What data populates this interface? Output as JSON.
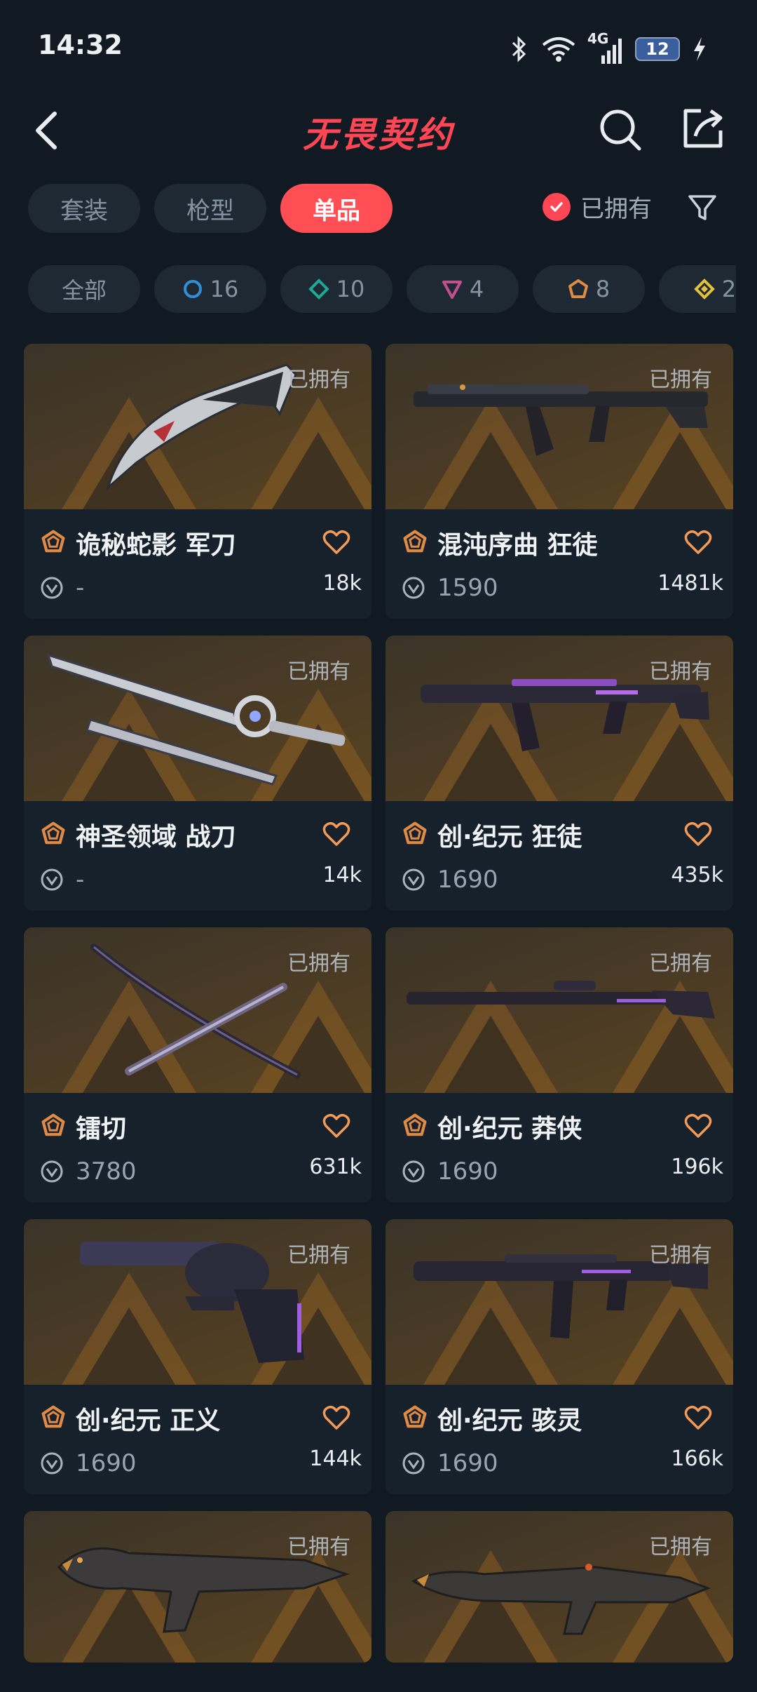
{
  "status": {
    "time": "14:32",
    "network": "4G",
    "battery": "12"
  },
  "header": {
    "title": "无畏契约"
  },
  "tabs": [
    {
      "label": "套装",
      "active": false
    },
    {
      "label": "枪型",
      "active": false
    },
    {
      "label": "单品",
      "active": true
    }
  ],
  "owned_filter": {
    "label": "已拥有",
    "checked": true
  },
  "rarity_chips": [
    {
      "label": "全部",
      "count": "",
      "icon": "all",
      "color": ""
    },
    {
      "label": "",
      "count": "16",
      "icon": "select-tier-icon",
      "color": "#2f8fd8"
    },
    {
      "label": "",
      "count": "10",
      "icon": "deluxe-tier-icon",
      "color": "#1fa894"
    },
    {
      "label": "",
      "count": "4",
      "icon": "premium-tier-icon",
      "color": "#c0508f"
    },
    {
      "label": "",
      "count": "8",
      "icon": "exclusive-tier-icon",
      "color": "#e08a44"
    },
    {
      "label": "",
      "count": "2",
      "icon": "ultra-tier-icon",
      "color": "#e3c23a"
    }
  ],
  "cards": [
    {
      "name": "诡秘蛇影 军刀",
      "price": "-",
      "likes": "18k",
      "owned": "已拥有",
      "weapon": "knife"
    },
    {
      "name": "混沌序曲 狂徒",
      "price": "1590",
      "likes": "1481k",
      "owned": "已拥有",
      "weapon": "rifle"
    },
    {
      "name": "神圣领域 战刀",
      "price": "-",
      "likes": "14k",
      "owned": "已拥有",
      "weapon": "blade"
    },
    {
      "name": "创·纪元 狂徒",
      "price": "1690",
      "likes": "435k",
      "owned": "已拥有",
      "weapon": "rifle"
    },
    {
      "name": "镭切",
      "price": "3780",
      "likes": "631k",
      "owned": "已拥有",
      "weapon": "katana"
    },
    {
      "name": "创·纪元 莽侠",
      "price": "1690",
      "likes": "196k",
      "owned": "已拥有",
      "weapon": "sniper"
    },
    {
      "name": "创·纪元 正义",
      "price": "1690",
      "likes": "144k",
      "owned": "已拥有",
      "weapon": "revolver"
    },
    {
      "name": "创·纪元 骇灵",
      "price": "1690",
      "likes": "166k",
      "owned": "已拥有",
      "weapon": "smg"
    },
    {
      "name": "",
      "price": "",
      "likes": "",
      "owned": "已拥有",
      "weapon": "dragon"
    },
    {
      "name": "",
      "price": "",
      "likes": "",
      "owned": "已拥有",
      "weapon": "dragon"
    }
  ]
}
